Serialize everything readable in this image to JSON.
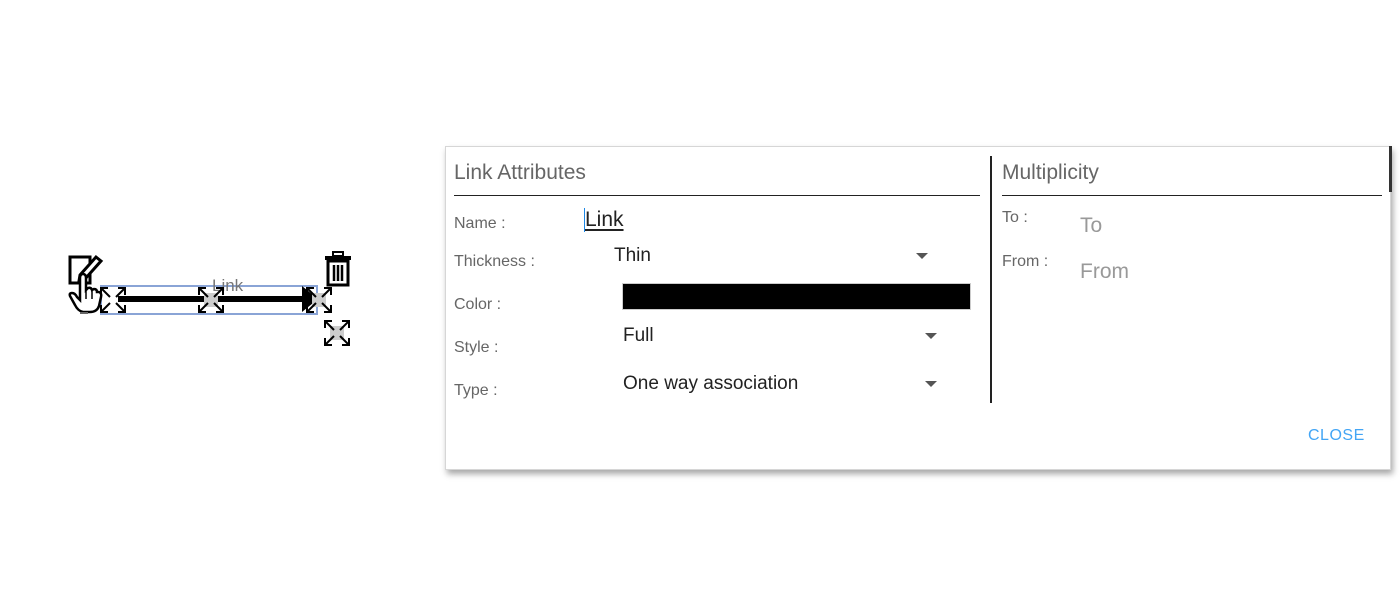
{
  "canvas": {
    "link_label": "Link",
    "icons": [
      "edit-icon",
      "delete-icon",
      "hand-pointer-icon",
      "move-handle-icon"
    ]
  },
  "dialog": {
    "attributes_title": "Link Attributes",
    "multiplicity_title": "Multiplicity",
    "fields": {
      "name_label": "Name :",
      "name_value": "Link",
      "thickness_label": "Thickness :",
      "thickness_value": "Thin",
      "color_label": "Color :",
      "color_value": "#000000",
      "style_label": "Style :",
      "style_value": "Full",
      "type_label": "Type :",
      "type_value": "One way association"
    },
    "multiplicity": {
      "to_label": "To :",
      "to_placeholder": "To",
      "from_label": "From :",
      "from_placeholder": "From"
    },
    "close_label": "CLOSE",
    "accent_color": "#42a5f5"
  }
}
